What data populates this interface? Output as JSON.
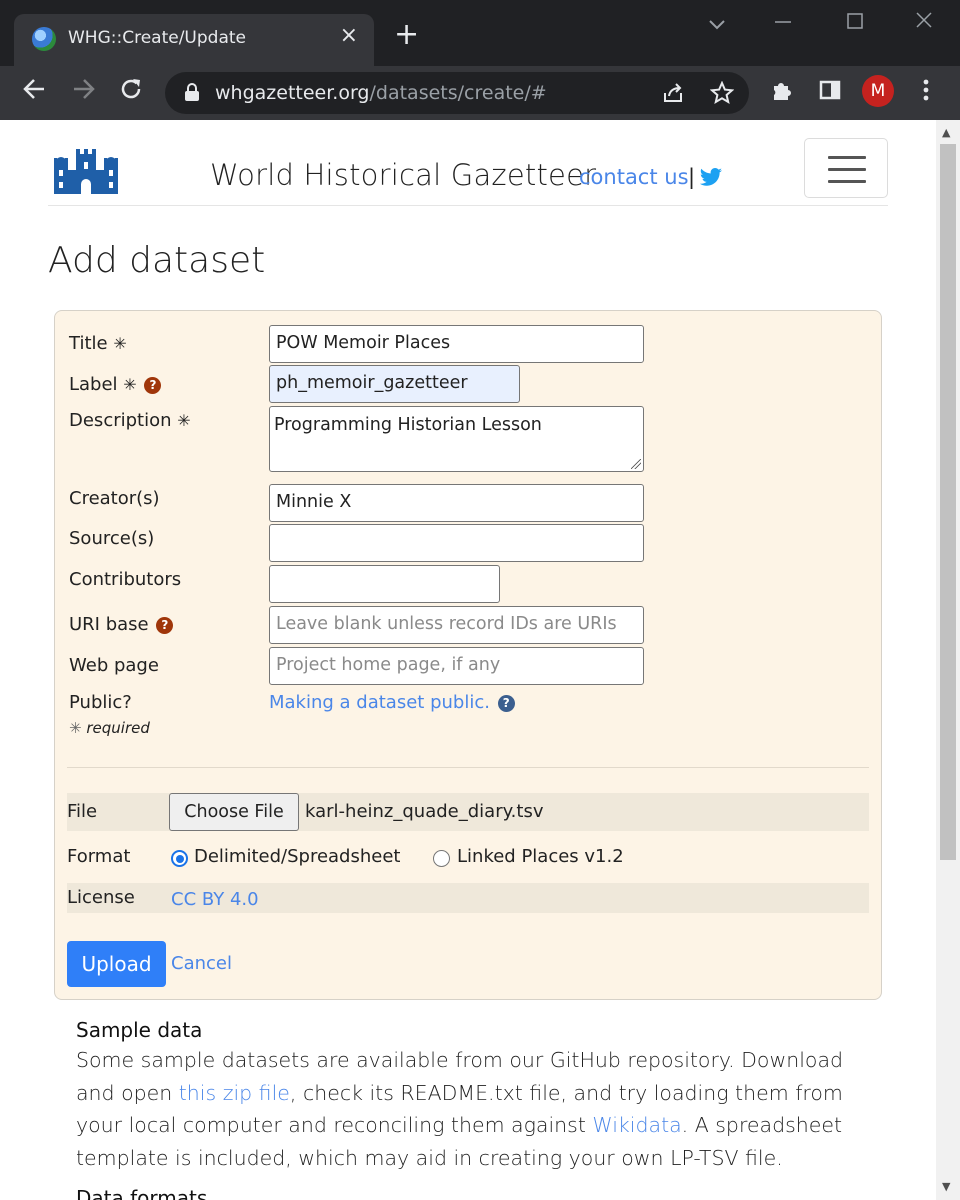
{
  "browser": {
    "tab_title": "WHG::Create/Update",
    "new_tab_glyph": "+",
    "close_glyph": "×",
    "url_host": "whgazetteer.org",
    "url_path": "/datasets/create/#",
    "profile_initial": "M"
  },
  "site": {
    "title": "World Historical Gazetteer",
    "contact_link": "contact us",
    "separator": "|"
  },
  "page": {
    "heading": "Add dataset"
  },
  "form": {
    "title_label": "Title",
    "title_value": "POW Memoir Places",
    "label_label": "Label",
    "label_value": "ph_memoir_gazetteer",
    "description_label": "Description",
    "description_value": "Programming Historian Lesson",
    "creators_label": "Creator(s)",
    "creators_value": "Minnie X",
    "sources_label": "Source(s)",
    "sources_value": "",
    "contributors_label": "Contributors",
    "contributors_value": "",
    "uri_base_label": "URI base",
    "uri_base_placeholder": "Leave blank unless record IDs are URIs",
    "web_page_label": "Web page",
    "web_page_placeholder": "Project home page, if any",
    "public_label": "Public?",
    "public_link": "Making a dataset public.",
    "required_star": "✳",
    "required_note": "required",
    "file_label": "File",
    "choose_file_button": "Choose File",
    "file_name": "karl-heinz_quade_diary.tsv",
    "format_label": "Format",
    "format_options": [
      "Delimited/Spreadsheet",
      "Linked Places v1.2"
    ],
    "format_selected": "Delimited/Spreadsheet",
    "license_label": "License",
    "license_value": "CC BY 4.0",
    "upload_button": "Upload",
    "cancel_link": "Cancel"
  },
  "sample": {
    "heading": "Sample data",
    "text_1": "Some sample datasets are available from our GitHub repository. Download and open ",
    "link_zip": "this zip file",
    "text_2": ", check its README.txt file, and try loading them from your local computer and reconciling them against ",
    "link_wikidata": "Wikidata",
    "text_3": ". A spreadsheet template is included, which may aid in creating your own LP-TSV file.",
    "next_heading": "Data formats"
  },
  "colors": {
    "link": "#4a86e8",
    "card_bg": "#fdf4e6",
    "primary_button": "#2f7ff8",
    "help_icon": "#a0360a"
  }
}
